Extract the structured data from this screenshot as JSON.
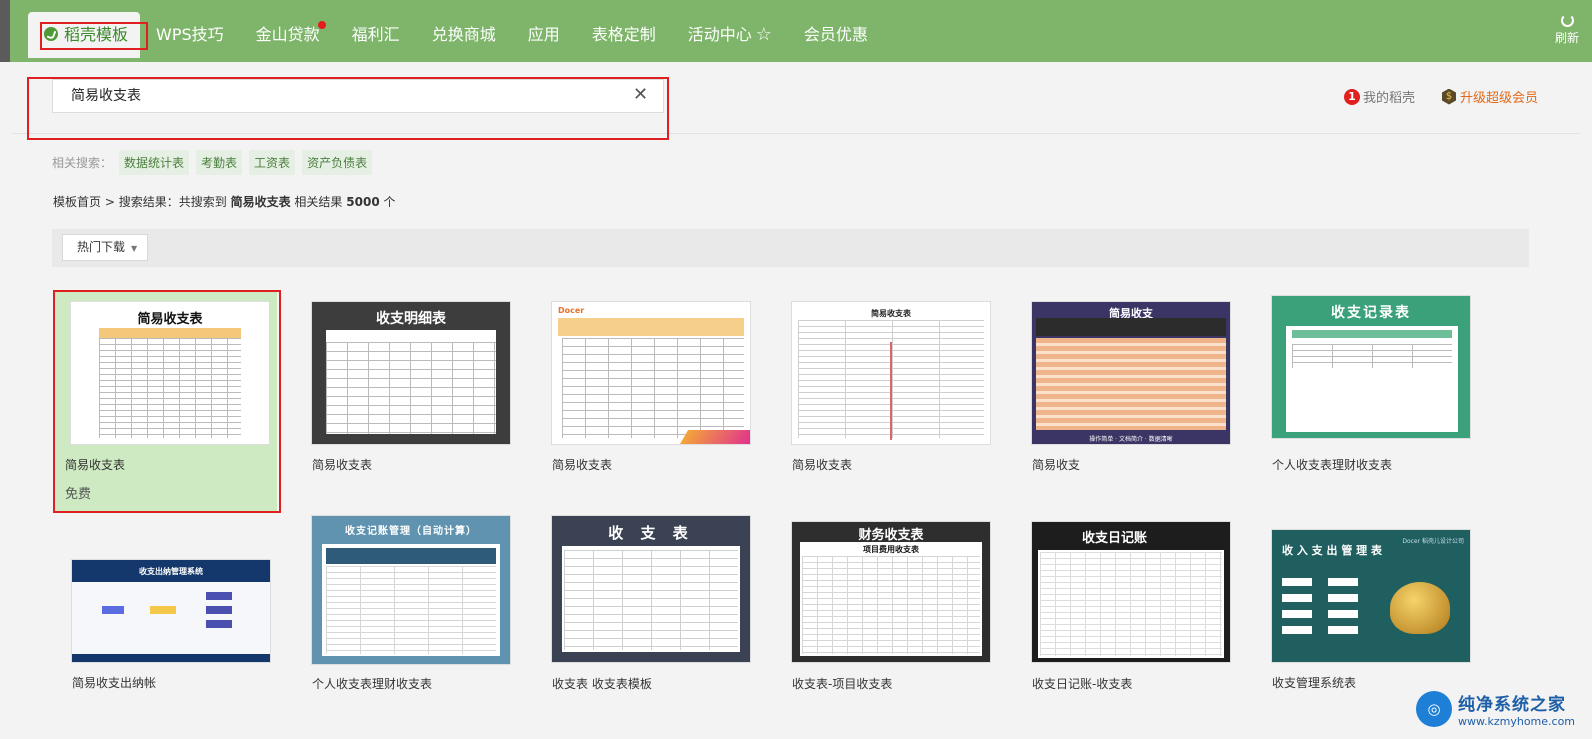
{
  "nav": {
    "items": [
      {
        "label": "稻壳模板"
      },
      {
        "label": "WPS技巧"
      },
      {
        "label": "金山贷款"
      },
      {
        "label": "福利汇"
      },
      {
        "label": "兑换商城"
      },
      {
        "label": "应用"
      },
      {
        "label": "表格定制"
      },
      {
        "label": "活动中心"
      },
      {
        "label": "会员优惠"
      }
    ],
    "refresh_label": "刷新"
  },
  "search": {
    "value": "简易收支表"
  },
  "account": {
    "my_docer": "我的稻壳",
    "my_docer_badge": "1",
    "upgrade": "升级超级会员"
  },
  "related": {
    "label": "相关搜索：",
    "tags": [
      "数据统计表",
      "考勤表",
      "工资表",
      "资产负债表"
    ]
  },
  "breadcrumb": {
    "home": "模板首页",
    "sep": ">",
    "prefix": "搜索结果：共搜索到",
    "keyword": "简易收支表",
    "count_prefix": "相关结果",
    "count": "5000",
    "unit": "个"
  },
  "filter": {
    "sort_label": "热门下载"
  },
  "cards": [
    {
      "title": "简易收支表",
      "price": "免费",
      "thumb_title": "简易收支表"
    },
    {
      "title": "简易收支表",
      "thumb_title": "收支明细表"
    },
    {
      "title": "简易收支表",
      "thumb_title": "Docer"
    },
    {
      "title": "简易收支表",
      "thumb_title": "简易收支表"
    },
    {
      "title": "简易收支",
      "thumb_title": "简易收支",
      "thumb_footer": "操作简单 · 文档简介 · 数据清晰"
    },
    {
      "title": "个人收支表理财收支表",
      "thumb_title": "收支记录表"
    },
    {
      "title": "简易收支出纳帐",
      "thumb_title": "收支出纳管理系统"
    },
    {
      "title": "个人收支表理财收支表",
      "thumb_title": "收支记账管理（自动计算）"
    },
    {
      "title": "收支表 收支表模板",
      "thumb_title": "收 支 表"
    },
    {
      "title": "收支表-项目收支表",
      "thumb_title": "财务收支表",
      "thumb_sub": "项目费用收支表"
    },
    {
      "title": "收支日记账-收支表",
      "thumb_title": "收支日记账"
    },
    {
      "title": "收支管理系统表",
      "thumb_title": "收 入 支 出 管 理 表",
      "thumb_brand": "Docer 稻壳儿设计公司"
    }
  ],
  "watermark": {
    "cn": "纯净系统之家",
    "en": "www.kzmyhome.com"
  }
}
